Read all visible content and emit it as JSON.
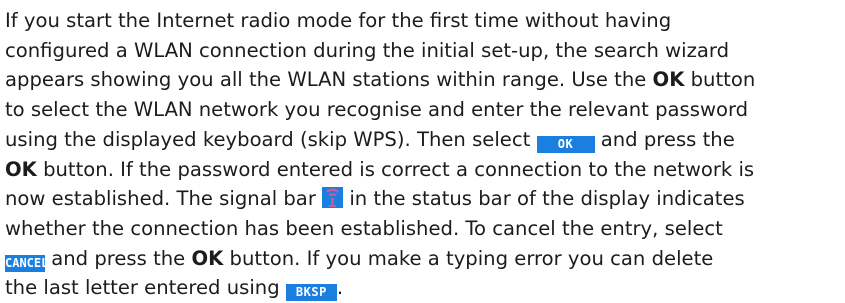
{
  "text": {
    "l1": "If you start the Internet radio mode for the first time without having",
    "l2": "configured a WLAN connection during the initial set-up, the search wizard",
    "l3a": "appears showing you all the WLAN stations within range. Use the ",
    "l3b": "OK",
    "l3c": " button",
    "l4": "to select the WLAN network you recognise and enter the relevant password",
    "l5a": "using the displayed keyboard (skip WPS). Then select ",
    "l5b": " and press the",
    "l6a": "OK",
    "l6b": " button. If the password entered is correct a connection to the network is",
    "l7a": "now established. The signal bar ",
    "l7b": " in the status bar of the display indicates",
    "l8": "whether the connection has been established. To cancel the entry, select",
    "l9a": " and press the ",
    "l9b": "OK",
    "l9c": " button. If you make a typing error you can delete",
    "l10a": "the last letter entered using ",
    "l10b": "."
  },
  "keys": {
    "ok": "OK",
    "cancel": "CANCEL",
    "bksp": "BKSP"
  },
  "icons": {
    "signal": "signal-bar-icon"
  },
  "colors": {
    "key_background": "#1b7fe0",
    "key_text": "#ffffff",
    "body_text": "#1c1c1c",
    "signal_glyph": "#c85a9e"
  }
}
